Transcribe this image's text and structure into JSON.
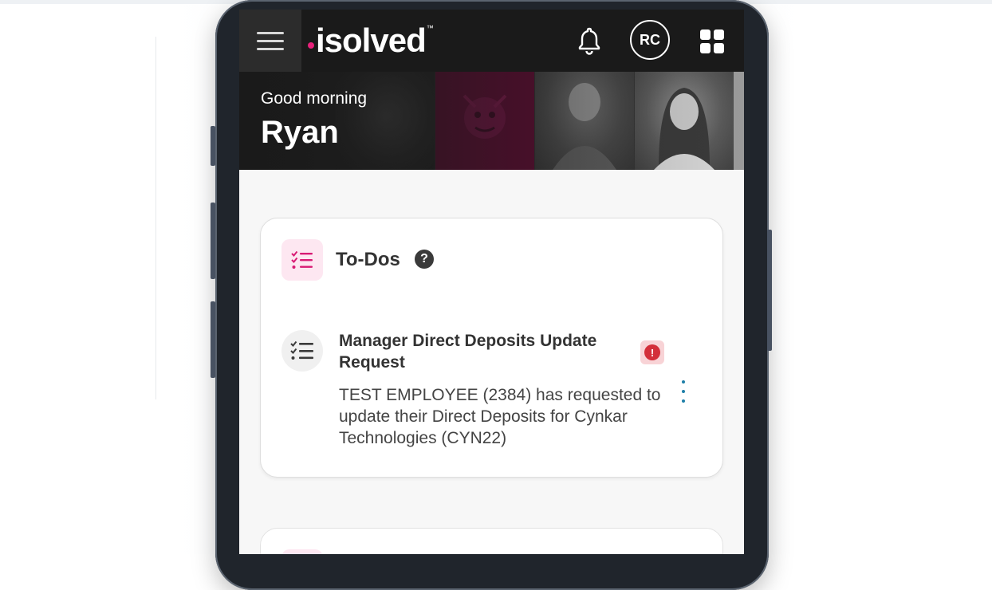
{
  "app": {
    "logo_text": "isolved",
    "logo_tm": "™",
    "user_initials": "RC",
    "accent_color": "#e7217a",
    "header_bg": "#1a1a1a"
  },
  "greeting": {
    "salutation": "Good morning",
    "name": "Ryan"
  },
  "todos": {
    "title": "To-Dos",
    "help_icon": "?",
    "items": [
      {
        "title": "Manager Direct Deposits Update Request",
        "description": "TEST EMPLOYEE (2384) has requested to update their Direct Deposits for Cynkar Technologies (CYN22)",
        "alert_icon": "!",
        "alert_color": "#d32f3a"
      }
    ]
  }
}
